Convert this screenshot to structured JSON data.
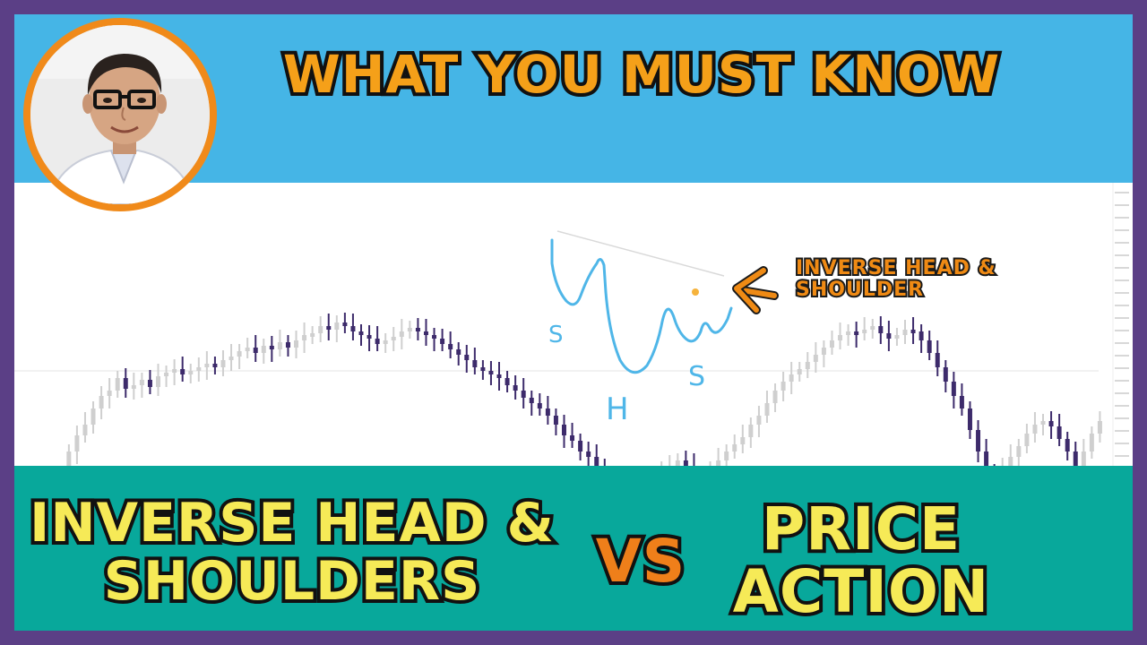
{
  "header": {
    "title": "WHAT YOU MUST KNOW"
  },
  "chart": {
    "callout_line1": "INVERSE HEAD &",
    "callout_line2": "SHOULDER",
    "label_left_shoulder": "S",
    "label_head": "H",
    "label_right_shoulder": "S",
    "price_series": [
      410,
      405,
      398,
      390,
      372,
      360,
      330,
      312,
      300,
      282,
      268,
      262,
      248,
      260,
      256,
      250,
      258,
      246,
      242,
      238,
      244,
      240,
      236,
      232,
      236,
      228,
      224,
      218,
      214,
      220,
      212,
      216,
      208,
      214,
      206,
      200,
      198,
      190,
      194,
      186,
      190,
      196,
      200,
      204,
      210,
      206,
      202,
      196,
      192,
      196,
      200,
      204,
      210,
      216,
      222,
      228,
      236,
      240,
      244,
      248,
      256,
      262,
      270,
      276,
      282,
      290,
      300,
      312,
      318,
      330,
      336,
      346,
      360,
      372,
      384,
      390,
      372,
      364,
      360,
      352,
      348,
      340,
      346,
      356,
      366,
      352,
      340,
      330,
      322,
      314,
      300,
      290,
      276,
      262,
      252,
      244,
      238,
      230,
      222,
      214,
      206,
      200,
      196,
      198,
      194,
      190,
      198,
      204,
      200,
      194,
      196,
      206,
      220,
      236,
      252,
      268,
      282,
      306,
      330,
      352,
      362,
      348,
      336,
      324,
      310,
      300,
      296,
      302,
      316,
      330,
      346,
      330,
      310,
      296
    ]
  },
  "footer": {
    "left_line1": "INVERSE HEAD &",
    "left_line2": "SHOULDERS",
    "vs": "VS",
    "right_line1": "PRICE",
    "right_line2": "ACTION"
  },
  "colors": {
    "frame": "#5b3f86",
    "top_band": "#45b5e6",
    "bottom_band": "#08a89b",
    "title": "#f5a019",
    "subject_text": "#f6ea57",
    "vs_text": "#ef7f1a",
    "callout": "#ef8a14",
    "annotation": "#4fb6e8",
    "candle_bull": "#cfcfcf",
    "candle_bear": "#3d2b6b"
  }
}
